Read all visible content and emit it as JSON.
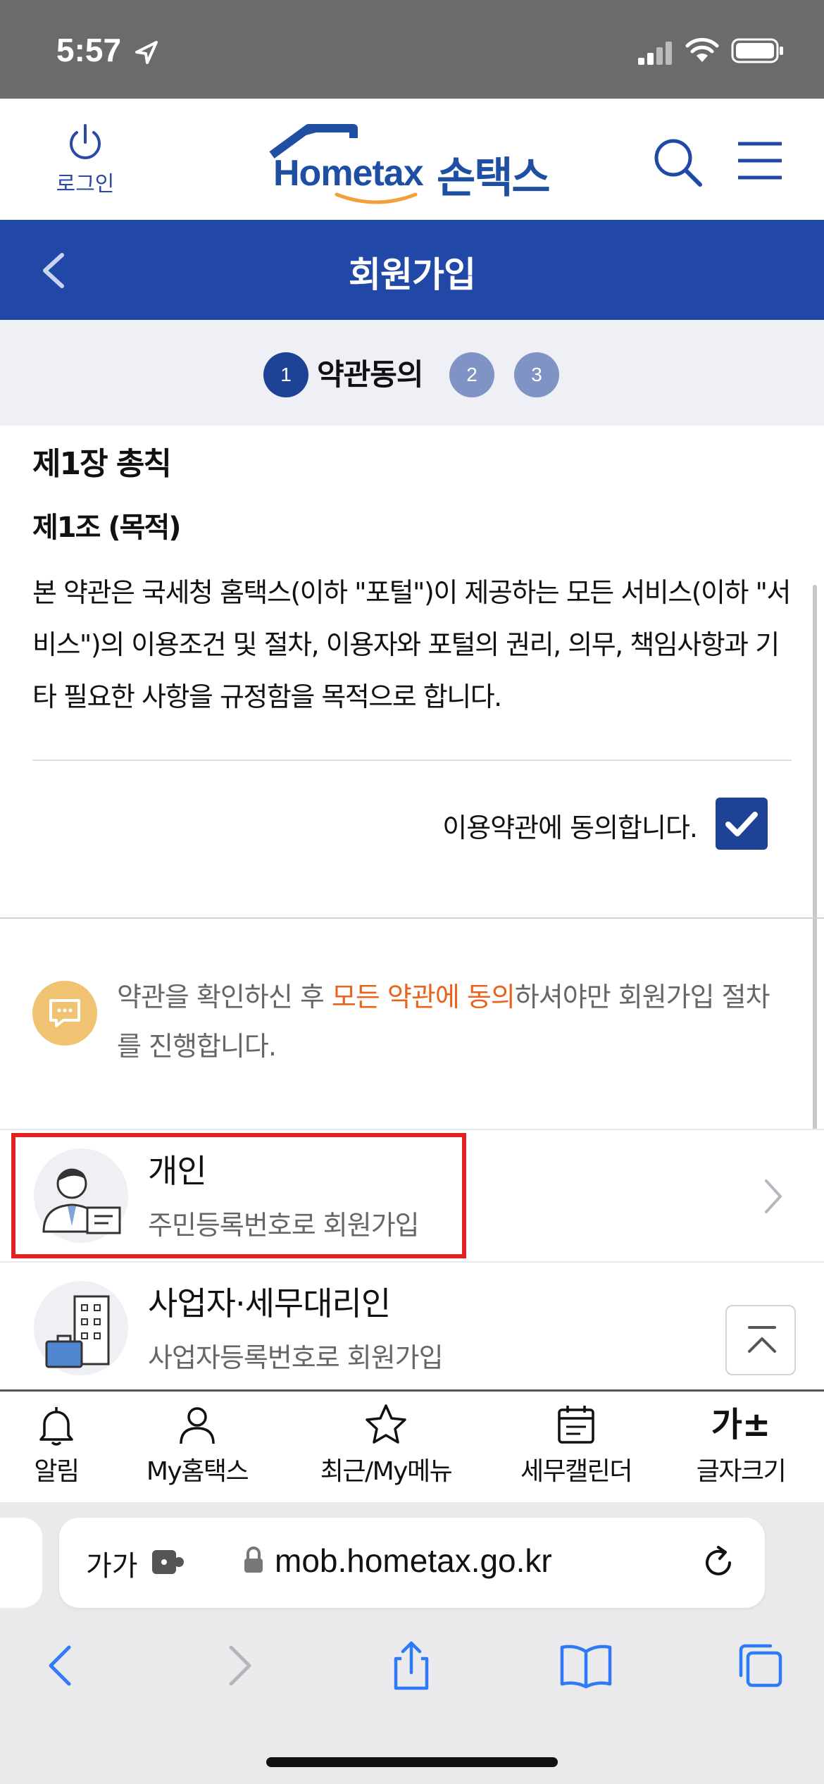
{
  "status_bar": {
    "time": "5:57"
  },
  "header": {
    "login_label": "로그인",
    "logo_brand": "Hometax",
    "logo_korean": "손택스"
  },
  "title_bar": {
    "title": "회원가입"
  },
  "steps": {
    "items": [
      "1",
      "2",
      "3"
    ],
    "active_label": "약관동의"
  },
  "terms": {
    "chapter": "제1장 총칙",
    "article": "제1조 (목적)",
    "body": "본 약관은 국세청 홈택스(이하 \"포털\")이 제공하는 모든 서비스(이하 \"서비스\")의 이용조건 및 절차, 이용자와 포털의 권리, 의무, 책임사항과 기타 필요한 사항을 규정함을 목적으로 합니다.",
    "agree_label": "이용약관에 동의합니다.",
    "agree_checked": true
  },
  "notice": {
    "prefix": "약관을 확인하신 후 ",
    "highlight": "모든 약관에 동의",
    "suffix": "하셔야만 회원가입 절차를 진행합니다.",
    "highlight_color": "#e8641e"
  },
  "options": [
    {
      "title": "개인",
      "subtitle": "주민등록번호로 회원가입",
      "icon": "person-icon"
    },
    {
      "title": "사업자·세무대리인",
      "subtitle": "사업자등록번호로 회원가입",
      "icon": "building-icon"
    }
  ],
  "bottom_nav": [
    {
      "label": "알림",
      "icon": "bell-icon"
    },
    {
      "label": "My홈택스",
      "icon": "user-icon"
    },
    {
      "label": "최근/My메뉴",
      "icon": "star-icon"
    },
    {
      "label": "세무캘린더",
      "icon": "calendar-icon"
    },
    {
      "label": "글자크기",
      "icon": "font-size-icon",
      "glyph": "가±"
    }
  ],
  "browser": {
    "text_size": "가가",
    "url": "mob.hometax.go.kr"
  },
  "colors": {
    "primary": "#2148a6",
    "step_inactive": "#7f93c4",
    "highlight_box": "#e02222",
    "notice_icon": "#f0c373"
  }
}
